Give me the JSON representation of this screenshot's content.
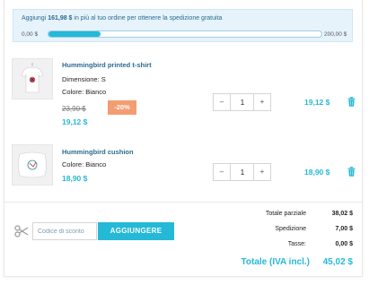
{
  "free_shipping": {
    "prefix": "Aggiungi ",
    "amount": "161,98 $",
    "suffix": " in più al tuo ordine per ottenere la spedizione gratuita",
    "min_label": "0,00 $",
    "max_label": "200,00 $",
    "progress_fraction": 0.19
  },
  "items": [
    {
      "name": "Hummingbird printed t-shirt",
      "size": "Dimensione: S",
      "color": "Colore: Bianco",
      "old_price": "23,90 $",
      "discount": "-20%",
      "unit_price": "19,12 $",
      "quantity": "1",
      "line_total": "19,12 $",
      "image_icon": "tshirt-product-image"
    },
    {
      "name": "Hummingbird cushion",
      "color": "Colore: Bianco",
      "unit_price": "18,90 $",
      "quantity": "1",
      "line_total": "18,90 $",
      "image_icon": "cushion-product-image"
    }
  ],
  "qty_controls": {
    "minus": "–",
    "plus": "+"
  },
  "promo": {
    "placeholder": "Codice di sconto",
    "button": "AGGIUNGERE",
    "icon": "scissors-icon"
  },
  "totals": {
    "subtotal_label": "Totale parziale",
    "subtotal_value": "38,02 $",
    "shipping_label": "Spedizione",
    "shipping_value": "7,00 $",
    "tax_label": "Tasse:",
    "tax_value": "0,00 $",
    "grand_label": "Totale (IVA incl.)",
    "grand_value": "45,02 $"
  },
  "colors": {
    "accent": "#24b9d7",
    "link": "#2b6a8f",
    "discount": "#f39d72",
    "banner_bg": "#e6f3fb"
  }
}
